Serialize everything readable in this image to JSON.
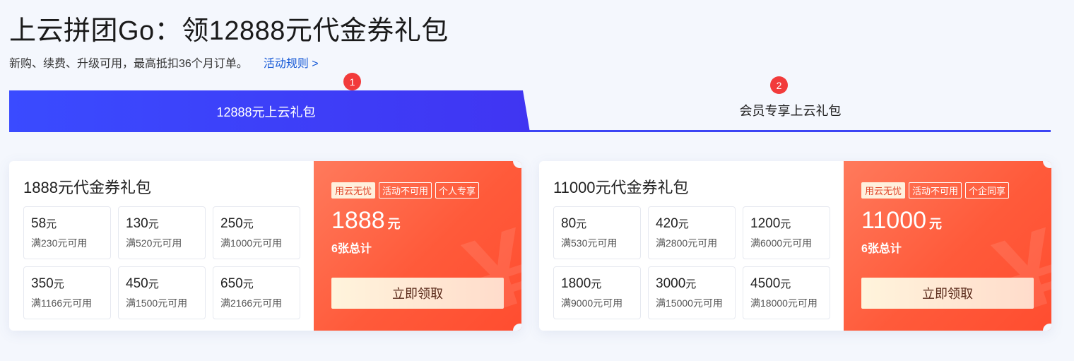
{
  "header": {
    "title": "上云拼团Go：领12888元代金券礼包",
    "subtitle": "新购、续费、升级可用，最高抵扣36个月订单。",
    "rules_link": "活动规则 >"
  },
  "tabs": [
    {
      "badge": "1",
      "label": "12888元上云礼包",
      "active": true
    },
    {
      "badge": "2",
      "label": "会员专享上云礼包",
      "active": false
    }
  ],
  "cards": [
    {
      "title": "1888元代金券礼包",
      "coupons": [
        {
          "amount": "58",
          "unit": "元",
          "condition": "满230元可用"
        },
        {
          "amount": "130",
          "unit": "元",
          "condition": "满520元可用"
        },
        {
          "amount": "250",
          "unit": "元",
          "condition": "满1000元可用"
        },
        {
          "amount": "350",
          "unit": "元",
          "condition": "满1166元可用"
        },
        {
          "amount": "450",
          "unit": "元",
          "condition": "满1500元可用"
        },
        {
          "amount": "650",
          "unit": "元",
          "condition": "满2166元可用"
        }
      ],
      "tags": [
        "用云无忧",
        "活动不可用",
        "个人专享"
      ],
      "total": "1888",
      "total_unit": "元",
      "count": "6张总计",
      "button": "立即领取"
    },
    {
      "title": "11000元代金券礼包",
      "coupons": [
        {
          "amount": "80",
          "unit": "元",
          "condition": "满530元可用"
        },
        {
          "amount": "420",
          "unit": "元",
          "condition": "满2800元可用"
        },
        {
          "amount": "1200",
          "unit": "元",
          "condition": "满6000元可用"
        },
        {
          "amount": "1800",
          "unit": "元",
          "condition": "满9000元可用"
        },
        {
          "amount": "3000",
          "unit": "元",
          "condition": "满15000元可用"
        },
        {
          "amount": "4500",
          "unit": "元",
          "condition": "满18000元可用"
        }
      ],
      "tags": [
        "用云无忧",
        "活动不可用",
        "个企同享"
      ],
      "total": "11000",
      "total_unit": "元",
      "count": "6张总计",
      "button": "立即领取"
    }
  ],
  "colors": {
    "accent_blue": "#3c45f4",
    "badge_red": "#f23b3b",
    "card_orange": "#ff5a3a",
    "link_blue": "#1659d6"
  }
}
